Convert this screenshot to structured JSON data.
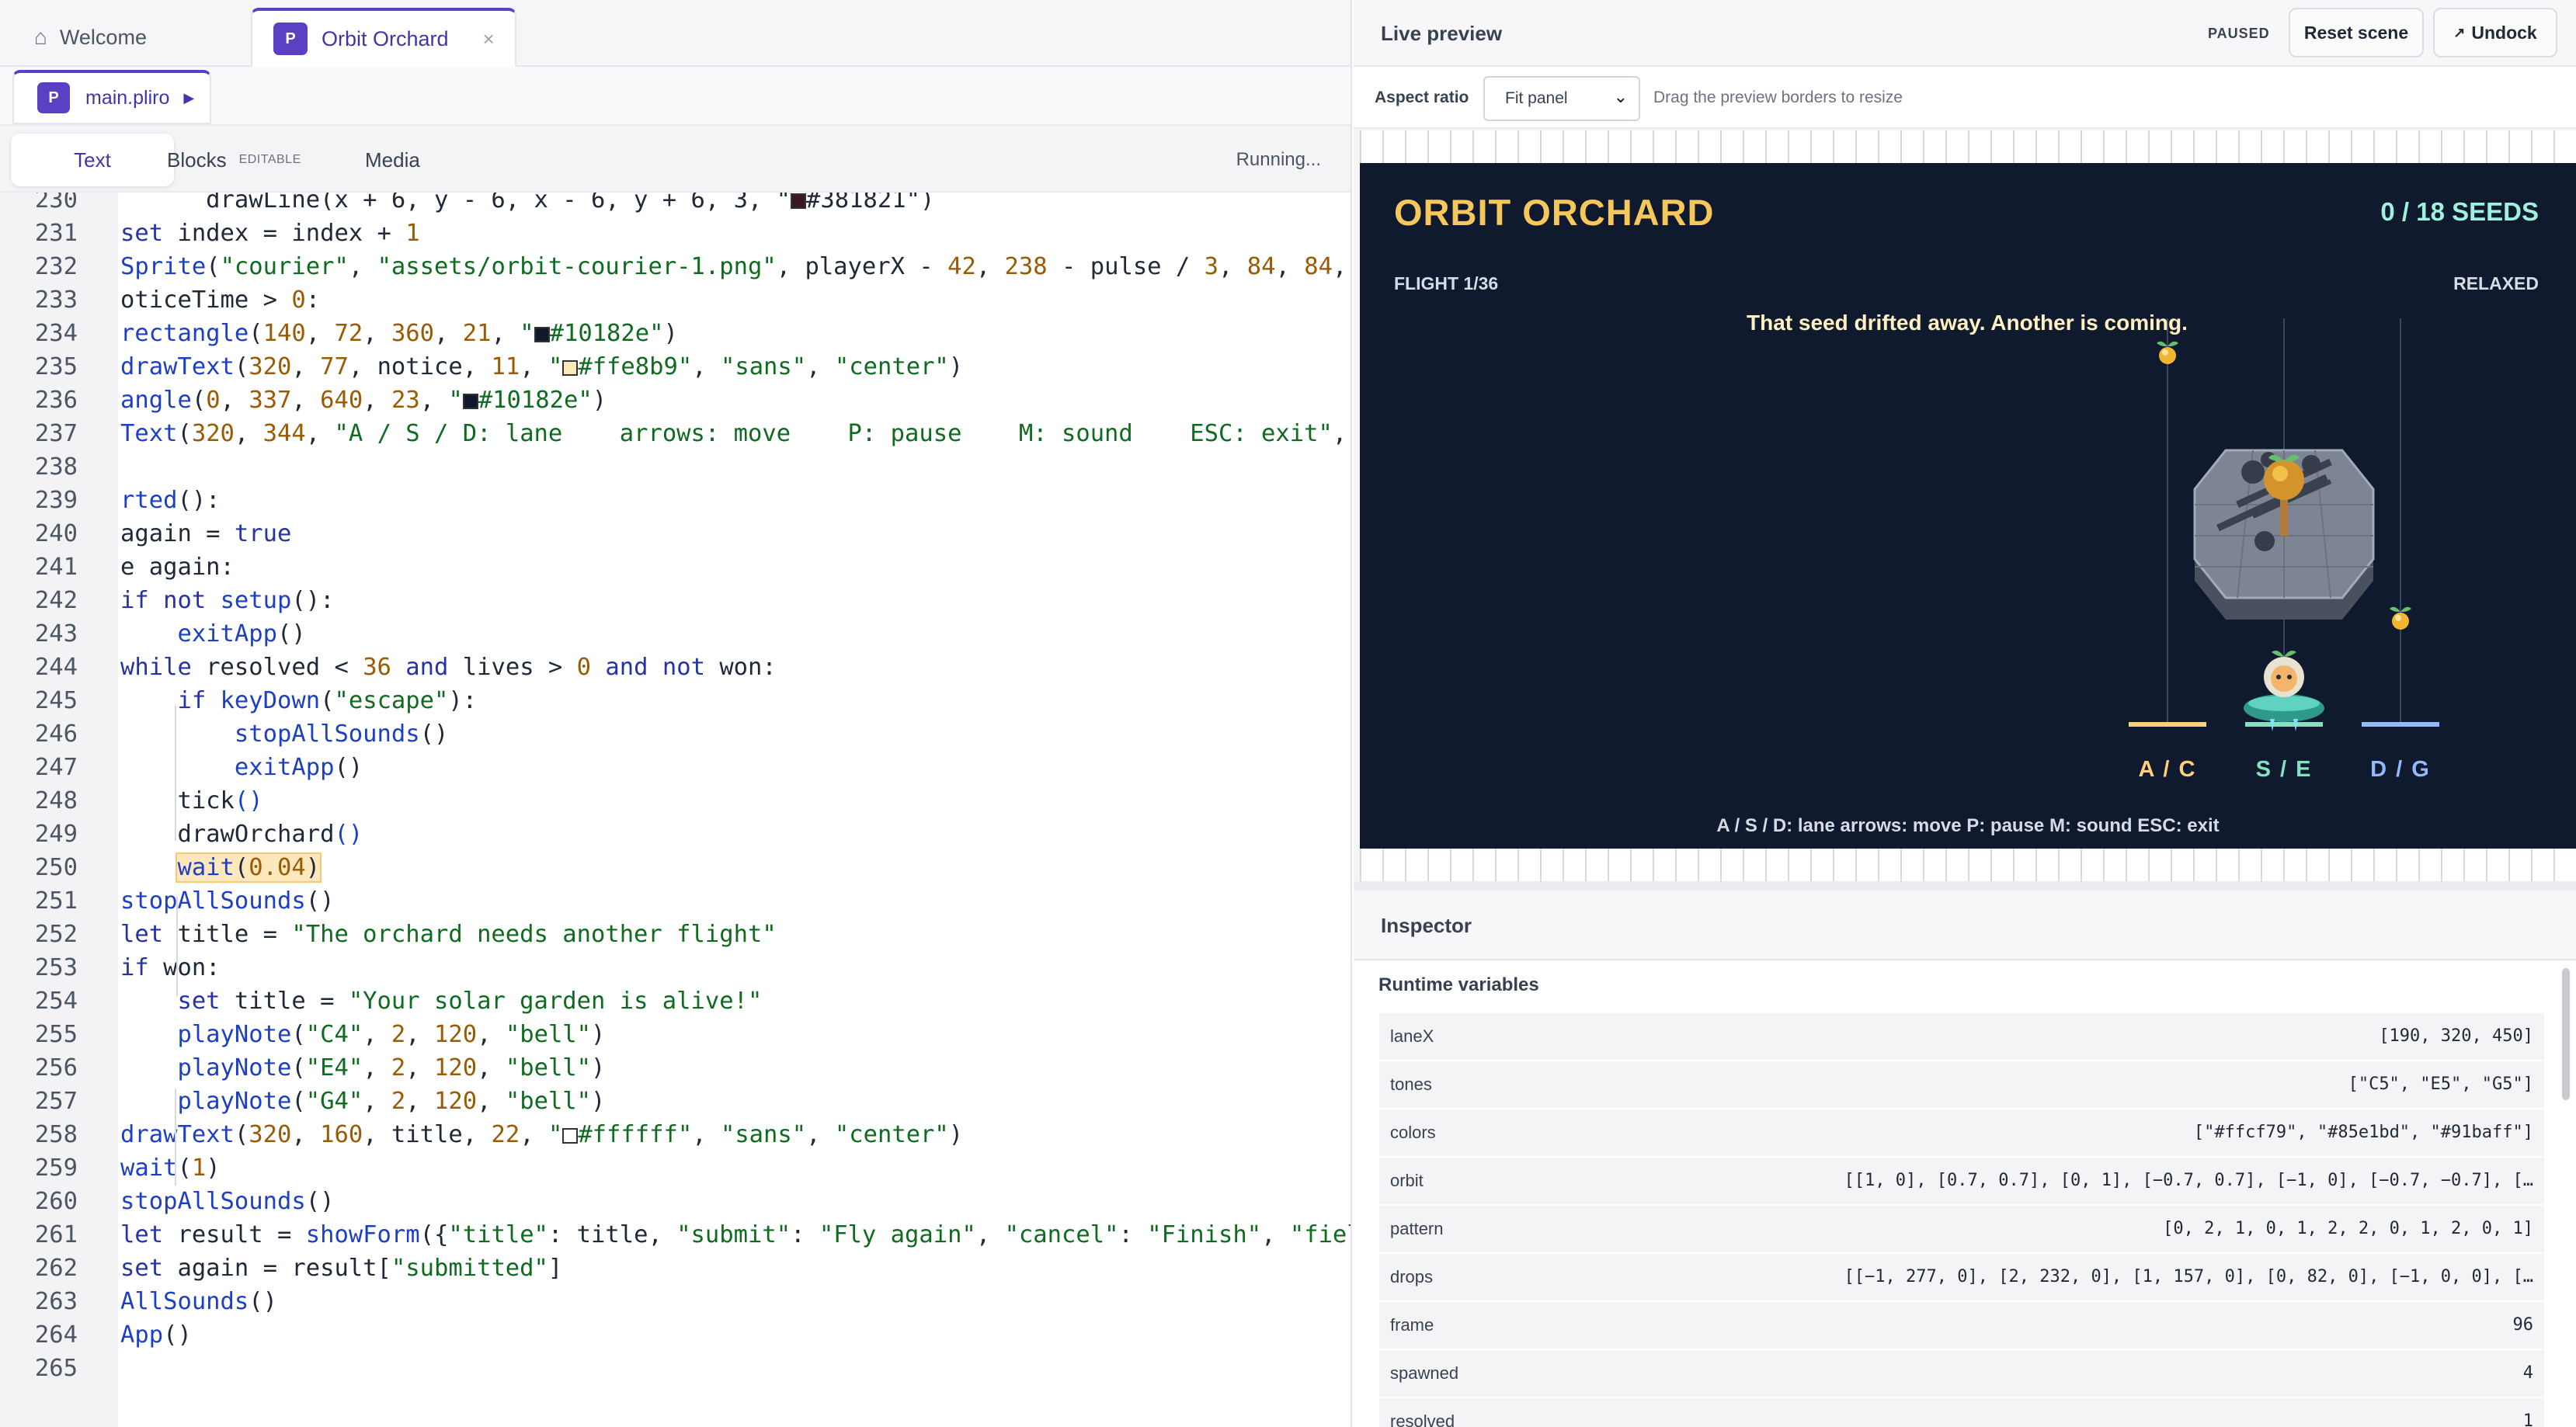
{
  "tabs": {
    "welcome": {
      "icon": "home-icon",
      "label": "Welcome"
    },
    "active": {
      "badge": "P",
      "label": "Orbit Orchard",
      "close": "×"
    }
  },
  "breadcrumb": {
    "badge": "P",
    "file": "main.pliro",
    "play": "▶"
  },
  "view_tabs": {
    "text": "Text",
    "blocks": "Blocks",
    "blocks_tag": "EDITABLE",
    "media": "Media",
    "status": "Running..."
  },
  "code_lines": [
    {
      "n": "230",
      "html": "      drawLine(x + 6, y - 6, x - 6, y + 6, 3, \"<span class='sw' style='background:#381821'></span>#381821\")"
    },
    {
      "n": "231",
      "html": "<span class='k'>set</span> index = index + <span class='n'>1</span>"
    },
    {
      "n": "232",
      "html": "<span class='f'>Sprite</span>(<span class='s'>\"courier\"</span>, <span class='s'>\"assets/orbit-courier-1.png\"</span>, playerX - <span class='n'>42</span>, <span class='n'>238</span> - pulse / <span class='n'>3</span>, <span class='n'>84</span>, <span class='n'>84</span>,"
    },
    {
      "n": "233",
      "html": "oticeTime &gt; <span class='n'>0</span>:"
    },
    {
      "n": "234",
      "html": "<span class='f'>rectangle</span>(<span class='n'>140</span>, <span class='n'>72</span>, <span class='n'>360</span>, <span class='n'>21</span>, <span class='s'>\"<span class='sw' style='background:#10182e'></span>#10182e\"</span>)"
    },
    {
      "n": "235",
      "html": "<span class='f'>drawText</span>(<span class='n'>320</span>, <span class='n'>77</span>, notice, <span class='n'>11</span>, <span class='s'>\"<span class='sw' style='background:#ffe8b9'></span>#ffe8b9\"</span>, <span class='s'>\"sans\"</span>, <span class='s'>\"center\"</span>)"
    },
    {
      "n": "236",
      "html": "<span class='f'>angle</span>(<span class='n'>0</span>, <span class='n'>337</span>, <span class='n'>640</span>, <span class='n'>23</span>, <span class='s'>\"<span class='sw' style='background:#10182e'></span>#10182e\"</span>)"
    },
    {
      "n": "237",
      "html": "<span class='f'>Text</span>(<span class='n'>320</span>, <span class='n'>344</span>, <span class='s'>\"A / S / D: lane    arrows: move    P: pause    M: sound    ESC: exit\"</span>,"
    },
    {
      "n": "238",
      "html": ""
    },
    {
      "n": "239",
      "html": "<span class='f'>rted</span>():"
    },
    {
      "n": "240",
      "html": "again = <span class='k'>true</span>"
    },
    {
      "n": "241",
      "html": "e again:"
    },
    {
      "n": "242",
      "html": "<span class='k'>if not</span> <span class='f'>setup</span>():"
    },
    {
      "n": "243",
      "html": "    <span class='f'>exitApp</span>()"
    },
    {
      "n": "244",
      "html": "<span class='k'>while</span> resolved &lt; <span class='n'>36</span> <span class='k'>and</span> lives &gt; <span class='n'>0</span> <span class='k'>and not</span> won:"
    },
    {
      "n": "245",
      "html": "    <span class='k'>if</span> <span class='f'>keyDown</span>(<span class='s'>\"escape\"</span>):"
    },
    {
      "n": "246",
      "html": "        <span class='f'>stopAllSounds</span>()"
    },
    {
      "n": "247",
      "html": "        <span class='f'>exitApp</span>()"
    },
    {
      "n": "248",
      "html": "    tick<span class='f'>()</span>"
    },
    {
      "n": "249",
      "html": "    drawOrchard<span class='f'>()</span>"
    },
    {
      "n": "250",
      "html": "    <span class='hl'><span class='f'>wait</span>(<span class='n'>0.04</span>)</span>"
    },
    {
      "n": "251",
      "html": "<span class='f'>stopAllSounds</span>()"
    },
    {
      "n": "252",
      "html": "<span class='k'>let</span> title = <span class='s'>\"The orchard needs another flight\"</span>"
    },
    {
      "n": "253",
      "html": "<span class='k'>if</span> won:"
    },
    {
      "n": "254",
      "html": "    <span class='k'>set</span> title = <span class='s'>\"Your solar garden is alive!\"</span>"
    },
    {
      "n": "255",
      "html": "    <span class='f'>playNote</span>(<span class='s'>\"C4\"</span>, <span class='n'>2</span>, <span class='n'>120</span>, <span class='s'>\"bell\"</span>)"
    },
    {
      "n": "256",
      "html": "    <span class='f'>playNote</span>(<span class='s'>\"E4\"</span>, <span class='n'>2</span>, <span class='n'>120</span>, <span class='s'>\"bell\"</span>)"
    },
    {
      "n": "257",
      "html": "    <span class='f'>playNote</span>(<span class='s'>\"G4\"</span>, <span class='n'>2</span>, <span class='n'>120</span>, <span class='s'>\"bell\"</span>)"
    },
    {
      "n": "258",
      "html": "<span class='f'>drawText</span>(<span class='n'>320</span>, <span class='n'>160</span>, title, <span class='n'>22</span>, <span class='s'>\"<span class='sw' style='background:#ffffff'></span>#ffffff\"</span>, <span class='s'>\"sans\"</span>, <span class='s'>\"center\"</span>)"
    },
    {
      "n": "259",
      "html": "<span class='f'>wait</span>(<span class='n'>1</span>)"
    },
    {
      "n": "260",
      "html": "<span class='f'>stopAllSounds</span>()"
    },
    {
      "n": "261",
      "html": "<span class='k'>let</span> result = <span class='f'>showForm</span>({<span class='s'>\"title\"</span>: title, <span class='s'>\"submit\"</span>: <span class='s'>\"Fly again\"</span>, <span class='s'>\"cancel\"</span>: <span class='s'>\"Finish\"</span>, <span class='s'>\"fiel</span>"
    },
    {
      "n": "262",
      "html": "<span class='k'>set</span> again = result[<span class='s'>\"submitted\"</span>]"
    },
    {
      "n": "263",
      "html": "<span class='f'>AllSounds</span>()"
    },
    {
      "n": "264",
      "html": "<span class='f'>App</span>()"
    },
    {
      "n": "265",
      "html": ""
    }
  ],
  "preview": {
    "title": "Live preview",
    "state": "PAUSED",
    "reset_label": "Reset scene",
    "undock_icon": "↗",
    "undock_label": "Undock",
    "aspect_label": "Aspect ratio",
    "aspect_value": "Fit panel",
    "aspect_chevron": "⌄",
    "hint": "Drag the preview borders to resize"
  },
  "game": {
    "title": "ORBIT ORCHARD",
    "score": "0 / 18 SEEDS",
    "flight": "FLIGHT 1/36",
    "mode": "RELAXED",
    "notice": "That seed drifted away. Another is coming.",
    "lanes": [
      {
        "label": "A / C",
        "color": "#ffcf79"
      },
      {
        "label": "S / E",
        "color": "#85e1bd"
      },
      {
        "label": "D / G",
        "color": "#91baff"
      }
    ],
    "help": "A / S / D: lane arrows: move P: pause M: sound ESC: exit"
  },
  "inspector": {
    "title": "Inspector",
    "section": "Runtime variables",
    "vars": [
      {
        "name": "laneX",
        "value": "[190, 320, 450]"
      },
      {
        "name": "tones",
        "value": "[\"C5\", \"E5\", \"G5\"]"
      },
      {
        "name": "colors",
        "value": "[\"#ffcf79\", \"#85e1bd\", \"#91baff\"]"
      },
      {
        "name": "orbit",
        "value": "[[1, 0], [0.7, 0.7], [0, 1], [−0.7, 0.7], [−1, 0], [−0.7, −0.7], […"
      },
      {
        "name": "pattern",
        "value": "[0, 2, 1, 0, 1, 2, 2, 0, 1, 2, 0, 1]"
      },
      {
        "name": "drops",
        "value": "[[−1, 277, 0], [2, 232, 0], [1, 157, 0], [0, 82, 0], [−1, 0, 0], […"
      },
      {
        "name": "frame",
        "value": "96"
      },
      {
        "name": "spawned",
        "value": "4"
      },
      {
        "name": "resolved",
        "value": "1"
      }
    ]
  }
}
